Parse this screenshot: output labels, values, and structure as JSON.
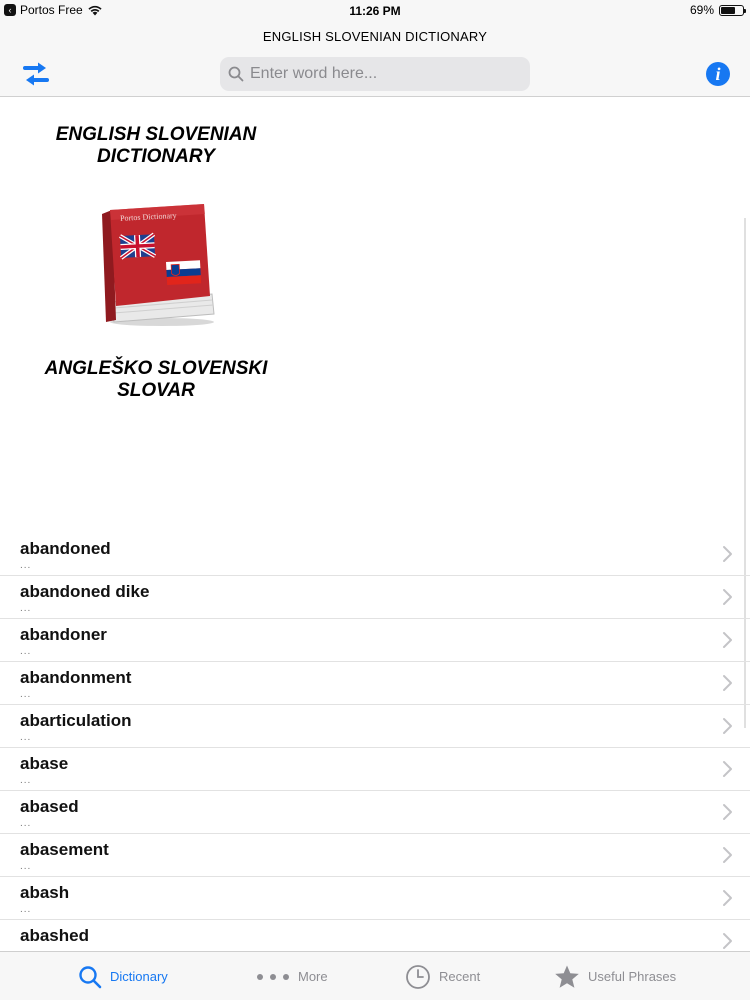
{
  "status": {
    "carrier": "Portos Free",
    "time": "11:26 PM",
    "battery": "69%",
    "battery_level": 0.69
  },
  "nav": {
    "title": "ENGLISH SLOVENIAN DICTIONARY",
    "search_placeholder": "Enter word here...",
    "info_label": "i"
  },
  "hero": {
    "title_en": "ENGLISH SLOVENIAN DICTIONARY",
    "title_sl": "ANGLEŠKO SLOVENSKI SLOVAR",
    "book_label": "Portos Dictionary"
  },
  "words": [
    {
      "word": "abandoned",
      "sub": "..."
    },
    {
      "word": "abandoned dike",
      "sub": "..."
    },
    {
      "word": "abandoner",
      "sub": "..."
    },
    {
      "word": "abandonment",
      "sub": "..."
    },
    {
      "word": "abarticulation",
      "sub": "..."
    },
    {
      "word": "abase",
      "sub": "..."
    },
    {
      "word": "abased",
      "sub": "..."
    },
    {
      "word": "abasement",
      "sub": "..."
    },
    {
      "word": "abash",
      "sub": "..."
    },
    {
      "word": "abashed",
      "sub": "..."
    }
  ],
  "tabs": [
    {
      "label": "Dictionary",
      "icon": "search-icon",
      "active": true
    },
    {
      "label": "More",
      "icon": "more-dots-icon",
      "active": false
    },
    {
      "label": "Recent",
      "icon": "clock-icon",
      "active": false
    },
    {
      "label": "Useful Phrases",
      "icon": "star-icon",
      "active": false
    }
  ],
  "colors": {
    "accent": "#1778f2",
    "inactive": "#8e8e93",
    "book_red": "#c0272d"
  }
}
